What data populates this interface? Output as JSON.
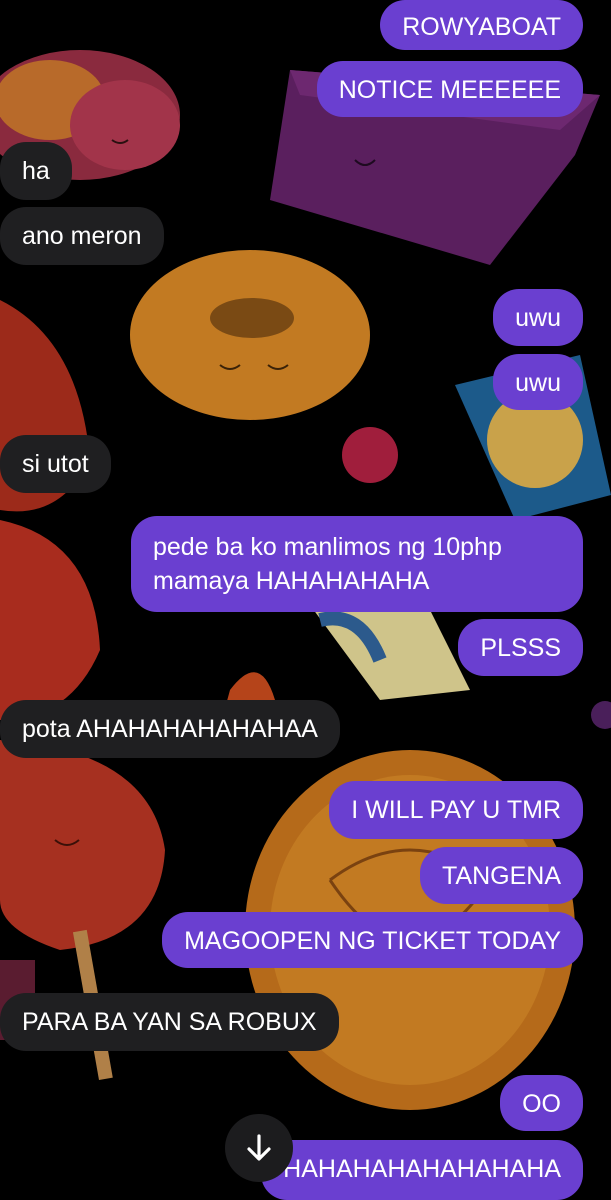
{
  "theme": {
    "outgoing_color": "#6a3fd0",
    "incoming_color": "#1f1f21",
    "background": "#000000"
  },
  "background": {
    "illustrations": [
      "pastry",
      "purple-cake",
      "donut",
      "candy-packet",
      "berry",
      "strawberry-skewer",
      "chips",
      "round-cake"
    ]
  },
  "messages": [
    {
      "side": "out",
      "text": "ROWYABOAT"
    },
    {
      "side": "out",
      "text": "NOTICE MEEEEEE"
    },
    {
      "side": "in",
      "text": "ha"
    },
    {
      "side": "in",
      "text": "ano meron"
    },
    {
      "side": "out",
      "text": "uwu"
    },
    {
      "side": "out",
      "text": "uwu"
    },
    {
      "side": "in",
      "text": "si utot"
    },
    {
      "side": "out",
      "text": "pede ba ko manlimos ng 10php mamaya HAHAHAHAHA"
    },
    {
      "side": "out",
      "text": "PLSSS"
    },
    {
      "side": "in",
      "text": "pota AHAHAHAHAHAHAA"
    },
    {
      "side": "out",
      "text": "I WILL PAY U TMR"
    },
    {
      "side": "out",
      "text": "TANGENA"
    },
    {
      "side": "out",
      "text": "MAGOOPEN NG TICKET TODAY"
    },
    {
      "side": "in",
      "text": "PARA BA YAN SA ROBUX"
    },
    {
      "side": "out",
      "text": "OO"
    },
    {
      "side": "out",
      "text": "HAHAHAHAHAHAHAHA"
    }
  ],
  "controls": {
    "scroll_down_icon": "arrow-down-icon"
  }
}
